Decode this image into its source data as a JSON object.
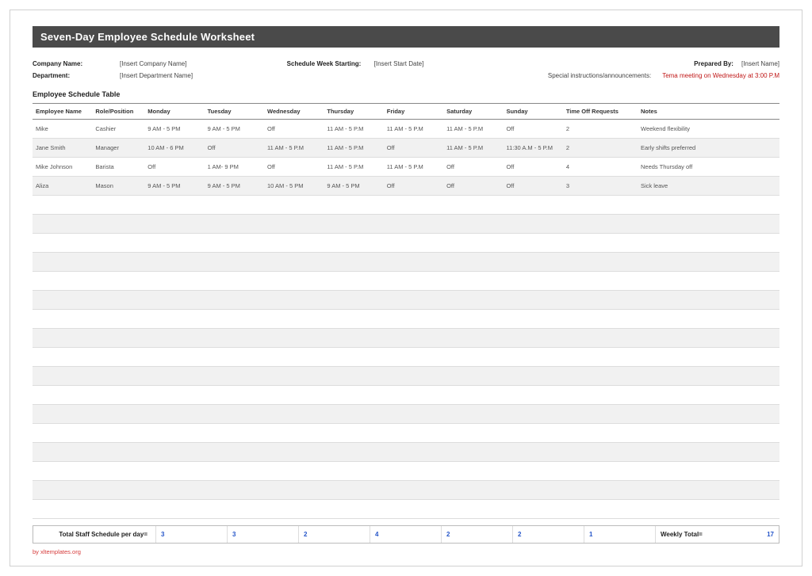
{
  "title": "Seven-Day Employee Schedule Worksheet",
  "meta": {
    "company_label": "Company Name:",
    "company_value": "[Insert Company Name]",
    "week_label": "Schedule Week Starting:",
    "week_value": "[Insert Start Date]",
    "prepared_label": "Prepared By:",
    "prepared_value": "[Insert Name]",
    "dept_label": "Department:",
    "dept_value": "[Insert Department Name]",
    "announce_label": "Special instructions/announcements:",
    "announce_value": "Tema meeting on Wednesday at 3:00 P.M"
  },
  "table": {
    "section_title": "Employee Schedule Table",
    "headers": [
      "Employee Name",
      "Role/Position",
      "Monday",
      "Tuesday",
      "Wednesday",
      "Thursday",
      "Friday",
      "Saturday",
      "Sunday",
      "Time Off Requests",
      "Notes"
    ],
    "rows": [
      {
        "c": [
          "Mike",
          "Cashier",
          "9 AM - 5 PM",
          "9 AM - 5 PM",
          "Off",
          "11 AM - 5 P.M",
          "11 AM - 5 P.M",
          "11 AM - 5 P.M",
          "Off",
          "2",
          "Weekend flexibility"
        ]
      },
      {
        "c": [
          "Jane Smith",
          "Manager",
          "10 AM - 6 PM",
          "Off",
          "11 AM - 5 P.M",
          "11 AM - 5 P.M",
          "Off",
          "11 AM - 5 P.M",
          "11:30 A.M - 5 P.M",
          "2",
          "Early shifts preferred"
        ]
      },
      {
        "c": [
          "Mike Johnson",
          "Barista",
          "Off",
          "1 AM- 9 PM",
          "Off",
          "11 AM - 5 P.M",
          "11 AM - 5 P.M",
          "Off",
          "Off",
          "4",
          "Needs Thursday off"
        ]
      },
      {
        "c": [
          "Aliza",
          "Mason",
          "9 AM - 5 PM",
          "9 AM - 5 PM",
          "10 AM - 5 PM",
          "9 AM - 5 PM",
          "Off",
          "Off",
          "Off",
          "3",
          "Sick leave"
        ]
      }
    ],
    "empty_rows": 17
  },
  "totals": {
    "label": "Total Staff Schedule per day=",
    "values": [
      "3",
      "3",
      "2",
      "4",
      "2",
      "2",
      "1"
    ],
    "weekly_label": "Weekly Total=",
    "weekly_value": "17"
  },
  "credit": "by xltemplates.org"
}
